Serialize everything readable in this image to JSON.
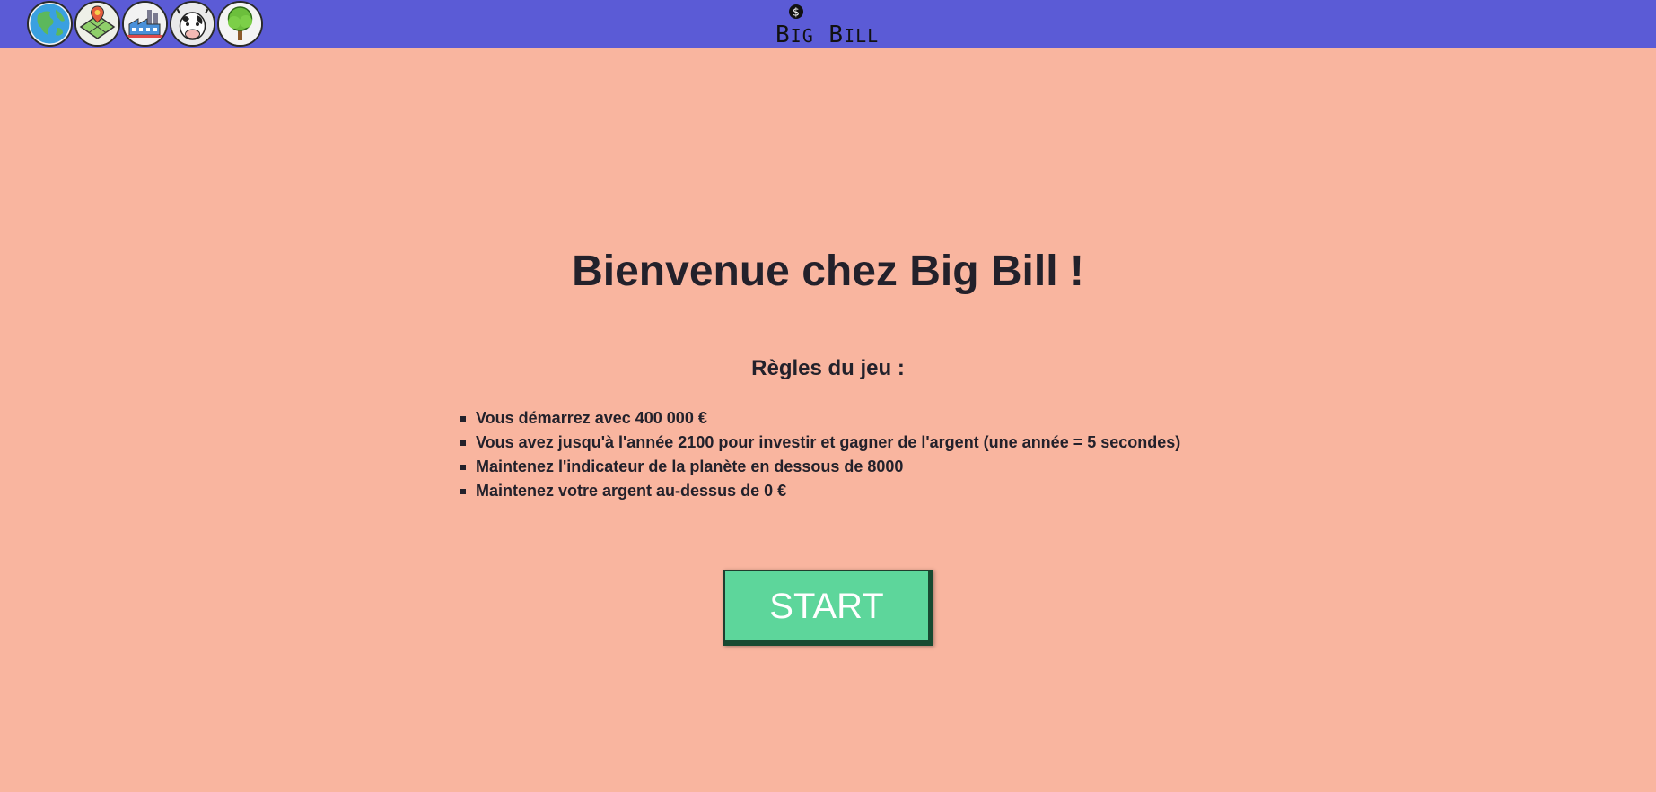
{
  "header": {
    "logo_text": "Big Bill",
    "nav": [
      {
        "icon": "earth-globe-icon"
      },
      {
        "icon": "land-map-icon"
      },
      {
        "icon": "factory-icon"
      },
      {
        "icon": "cow-icon"
      },
      {
        "icon": "tree-icon"
      }
    ],
    "colors": {
      "bar": "#5b5bd6"
    }
  },
  "main": {
    "title": "Bienvenue chez Big Bill !",
    "rules_heading": "Règles du jeu :",
    "rules": [
      "Vous démarrez avec 400 000 €",
      "Vous avez jusqu'à l'année 2100 pour investir et gagner de l'argent (une année = 5 secondes)",
      "Maintenez l'indicateur de la planète en dessous de 8000",
      "Maintenez votre argent au-dessus de 0 €"
    ],
    "start_label": "START",
    "colors": {
      "background": "#f9b59f",
      "start_button": "#5dd69b"
    }
  }
}
